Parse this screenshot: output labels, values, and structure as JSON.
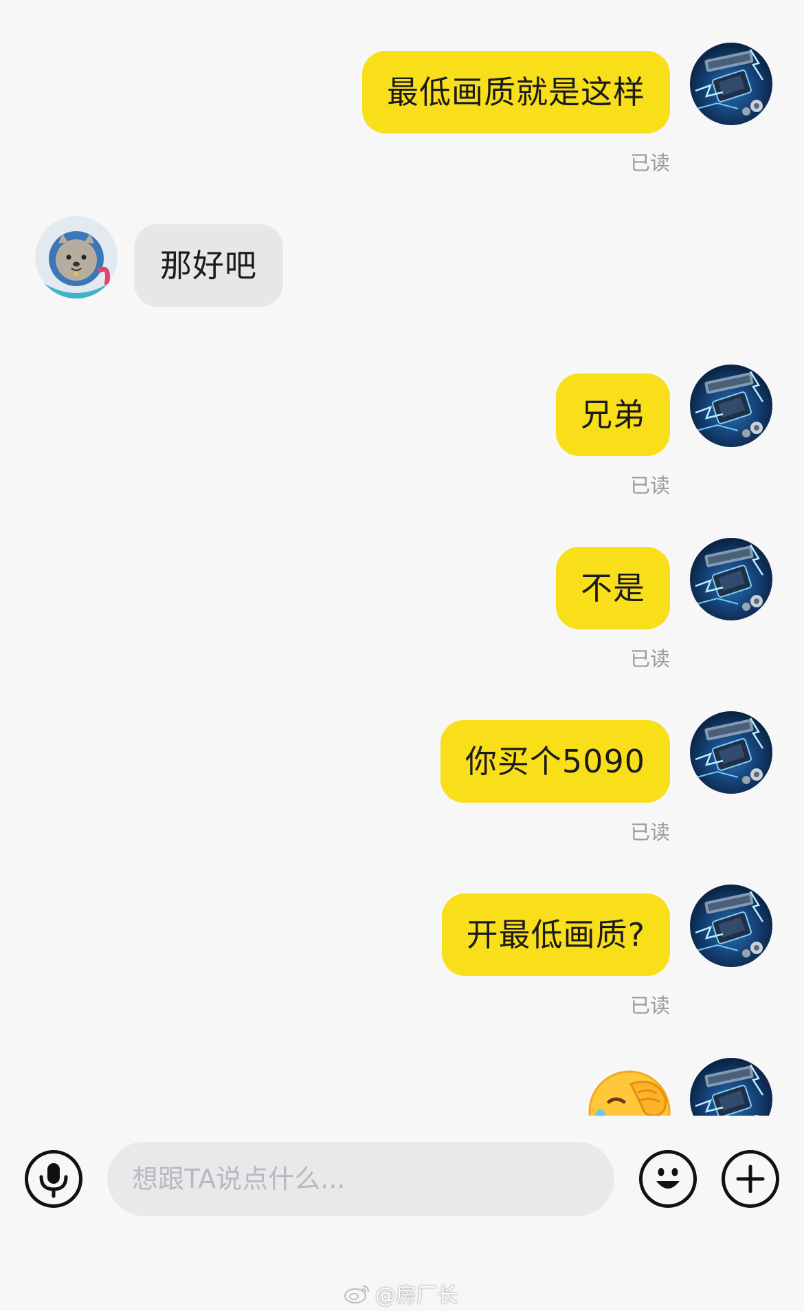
{
  "chat": {
    "messages": [
      {
        "side": "mine",
        "text": "最低画质就是这样",
        "status": "已读"
      },
      {
        "side": "theirs",
        "text": "那好吧"
      },
      {
        "side": "mine",
        "text": "兄弟",
        "status": "已读"
      },
      {
        "side": "mine",
        "text": "不是",
        "status": "已读"
      },
      {
        "side": "mine",
        "text": "你买个5090",
        "status": "已读"
      },
      {
        "side": "mine",
        "text": "开最低画质?",
        "status": "已读"
      },
      {
        "side": "mine",
        "emoji": "face-palm-crying-emoji"
      }
    ]
  },
  "input": {
    "placeholder": "想跟TA说点什么..."
  },
  "icons": {
    "voice": "microphone-icon",
    "emoji": "smile-icon",
    "more": "plus-icon"
  },
  "watermark": {
    "text": "@房厂长"
  },
  "colors": {
    "my_bubble": "#f8df1a",
    "their_bubble": "#e7e7ea",
    "background": "#f7f7f7",
    "read_status": "#9a9a9a"
  }
}
